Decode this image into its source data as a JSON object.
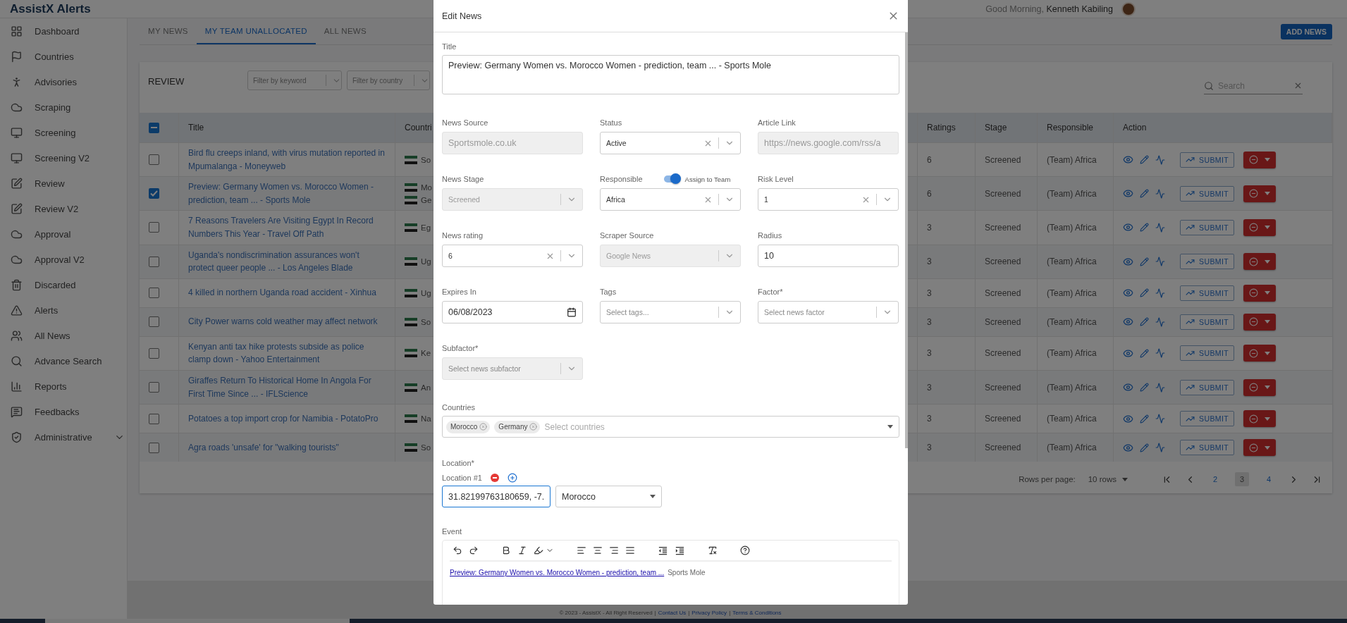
{
  "header": {
    "logo": "AssistX Alerts",
    "greeting": "Good Morning, **Kenneth Kabiling**"
  },
  "sidebar": {
    "items": [
      {
        "label": "Dashboard",
        "kind": "link"
      },
      {
        "label": "Countries",
        "kind": "link"
      },
      {
        "label": "Advisories",
        "kind": "link"
      },
      {
        "label": "Scraping",
        "kind": "link"
      },
      {
        "label": "Screening",
        "kind": "link"
      },
      {
        "label": "Screening V2",
        "kind": "link"
      },
      {
        "label": "Review",
        "kind": "link"
      },
      {
        "label": "Review V2",
        "kind": "link"
      },
      {
        "label": "Approval",
        "kind": "link"
      },
      {
        "label": "Approval V2",
        "kind": "link"
      },
      {
        "label": "Discarded",
        "kind": "link"
      },
      {
        "label": "Alerts",
        "kind": "link"
      },
      {
        "label": "All News",
        "kind": "link"
      },
      {
        "label": "Advance Search",
        "kind": "link"
      },
      {
        "label": "Reports",
        "kind": "link"
      },
      {
        "label": "Feedbacks",
        "kind": "link"
      },
      {
        "label": "Administrative",
        "kind": "group",
        "expanded": false
      }
    ]
  },
  "tabs": [
    {
      "label": "MY NEWS",
      "selected": false
    },
    {
      "label": "MY TEAM UNALLOCATED",
      "selected": true
    },
    {
      "label": "ALL NEWS",
      "selected": false
    }
  ],
  "add_button": "ADD NEWS",
  "review": {
    "title": "REVIEW",
    "filters": [
      {
        "placeholder": "Filter by keyword"
      },
      {
        "placeholder": "Filter by country"
      }
    ],
    "search": {
      "placeholder": "Search"
    }
  },
  "table": {
    "select_all": {
      "indeterminate": true
    },
    "columns": [
      "Title",
      "Countri",
      "Ratings",
      "Stage",
      "Responsible",
      "Action"
    ],
    "rows": [
      {
        "selected": false,
        "title": "Bird flu creeps inland, with virus mutation reported in Mpumalanga - Moneyweb",
        "countries": [
          {
            "name": "So"
          }
        ],
        "rating": "6",
        "stage": "Screened",
        "responsible": "(Team) Africa",
        "submit": "SUBMIT"
      },
      {
        "selected": true,
        "title": "Preview: Germany Women vs. Morocco Women - prediction, team ... - Sports Mole",
        "countries": [
          {
            "name": "Mo"
          },
          {
            "name": "Ge"
          }
        ],
        "rating": "6",
        "stage": "Screened",
        "responsible": "(Team) Africa",
        "submit": "SUBMIT"
      },
      {
        "selected": false,
        "title": "7 Reasons Travelers Are Visiting Egypt In Record Numbers This Year - Travel Off Path",
        "countries": [
          {
            "name": "Eg"
          }
        ],
        "rating": "3",
        "stage": "Screened",
        "responsible": "(Team) Africa",
        "submit": "SUBMIT"
      },
      {
        "selected": false,
        "title": "Uganda's nondiscrimination assurances won't protect queer people ... - Los Angeles Blade",
        "countries": [
          {
            "name": "Ug"
          }
        ],
        "rating": "3",
        "stage": "Screened",
        "responsible": "(Team) Africa",
        "submit": "SUBMIT"
      },
      {
        "selected": false,
        "title": "4 killed in northern Uganda road accident - Xinhua",
        "countries": [
          {
            "name": "Ug"
          }
        ],
        "rating": "3",
        "stage": "Screened",
        "responsible": "(Team) Africa",
        "submit": "SUBMIT"
      },
      {
        "selected": false,
        "title": "City Power warns cold weather may affect network",
        "countries": [
          {
            "name": "So"
          }
        ],
        "rating": "3",
        "stage": "Screened",
        "responsible": "(Team) Africa",
        "submit": "SUBMIT"
      },
      {
        "selected": false,
        "title": "Kenyan anti tax hike protests subside as police clamp down - Yahoo Entertainment",
        "countries": [
          {
            "name": "Ke"
          }
        ],
        "rating": "3",
        "stage": "Screened",
        "responsible": "(Team) Africa",
        "submit": "SUBMIT"
      },
      {
        "selected": false,
        "title": "Giraffes Return To Historical Home In Angola For First Time Since ... - IFLScience",
        "countries": [
          {
            "name": "An"
          }
        ],
        "rating": "3",
        "stage": "Screened",
        "responsible": "(Team) Africa",
        "submit": "SUBMIT"
      },
      {
        "selected": false,
        "title": "Potatoes a top import crop for Namibia - PotatoPro",
        "countries": [
          {
            "name": "Na"
          }
        ],
        "rating": "3",
        "stage": "Screened",
        "responsible": "(Team) Africa",
        "submit": "SUBMIT"
      },
      {
        "selected": false,
        "title": "Agra roads 'unsafe' for \"walking tourists\"",
        "countries": [
          {
            "name": "So"
          }
        ],
        "rating": "3",
        "stage": "Screened",
        "responsible": "(Team) Africa",
        "submit": "SUBMIT"
      }
    ]
  },
  "pagination": {
    "rows_label": "Rows per page:",
    "rows_value": "10 rows",
    "pages": [
      {
        "label": "2",
        "selected": false
      },
      {
        "label": "3",
        "selected": true
      },
      {
        "label": "4",
        "selected": false
      }
    ]
  },
  "footer": [
    {
      "kind": "text",
      "text": "© 2023 - AssistX - All Right Reserved"
    },
    {
      "kind": "text",
      "text": "|"
    },
    {
      "kind": "link",
      "text": "Contact Us"
    },
    {
      "kind": "text",
      "text": "|"
    },
    {
      "kind": "link",
      "text": "Privacy Policy"
    },
    {
      "kind": "text",
      "text": "|"
    },
    {
      "kind": "link",
      "text": "Terms & Conditions"
    }
  ],
  "modal": {
    "title": "Edit News",
    "title_field": {
      "label": "Title",
      "value": "Preview: Germany Women vs. Morocco Women - prediction, team ... - Sports Mole"
    },
    "fields": [
      {
        "label": "News Source",
        "kind": "input",
        "value": "Sportsmole.co.uk",
        "disabled": true
      },
      {
        "label": "Status",
        "kind": "select",
        "value": "Active",
        "clearable": true,
        "disabled": false
      },
      {
        "label": "Article Link",
        "kind": "input",
        "value": "https://news.google.com/rss/a",
        "disabled": true
      },
      {
        "label": "News Stage",
        "kind": "select",
        "value": "Screened",
        "clearable": false,
        "disabled": true
      },
      {
        "label": "Responsible",
        "kind": "select",
        "value": "Africa",
        "clearable": true,
        "disabled": false,
        "toggle": {
          "label": "Assign to Team",
          "on": true
        }
      },
      {
        "label": "Risk Level",
        "kind": "select",
        "value": "1",
        "clearable": true,
        "disabled": false
      },
      {
        "label": "News rating",
        "kind": "select",
        "value": "6",
        "clearable": true,
        "disabled": false
      },
      {
        "label": "Scraper Source",
        "kind": "select",
        "value": "Google News",
        "clearable": false,
        "disabled": true
      },
      {
        "label": "Radius",
        "kind": "input",
        "value": "10",
        "disabled": false
      },
      {
        "label": "Expires In",
        "kind": "date",
        "value": "06/08/2023",
        "disabled": false
      },
      {
        "label": "Tags",
        "kind": "select",
        "placeholder": "Select tags...",
        "clearable": false,
        "disabled": false
      },
      {
        "label": "Factor*",
        "kind": "select",
        "placeholder": "Select news factor",
        "clearable": false,
        "disabled": false
      },
      {
        "label": "Subfactor*",
        "kind": "select",
        "placeholder": "Select news subfactor",
        "clearable": false,
        "disabled": true
      }
    ],
    "countries": {
      "label": "Countries",
      "chips": [
        "Morocco",
        "Germany"
      ],
      "placeholder": "Select countries"
    },
    "location": {
      "label": "Location*",
      "items": [
        {
          "label": "Location #1",
          "coordinates": "31.82199763180659, -7.",
          "focused": true,
          "country": "Morocco"
        }
      ]
    },
    "event": {
      "label": "Event",
      "link": "Preview: Germany Women vs. Morocco Women - prediction, team ...",
      "text": "Sports Mole"
    }
  }
}
